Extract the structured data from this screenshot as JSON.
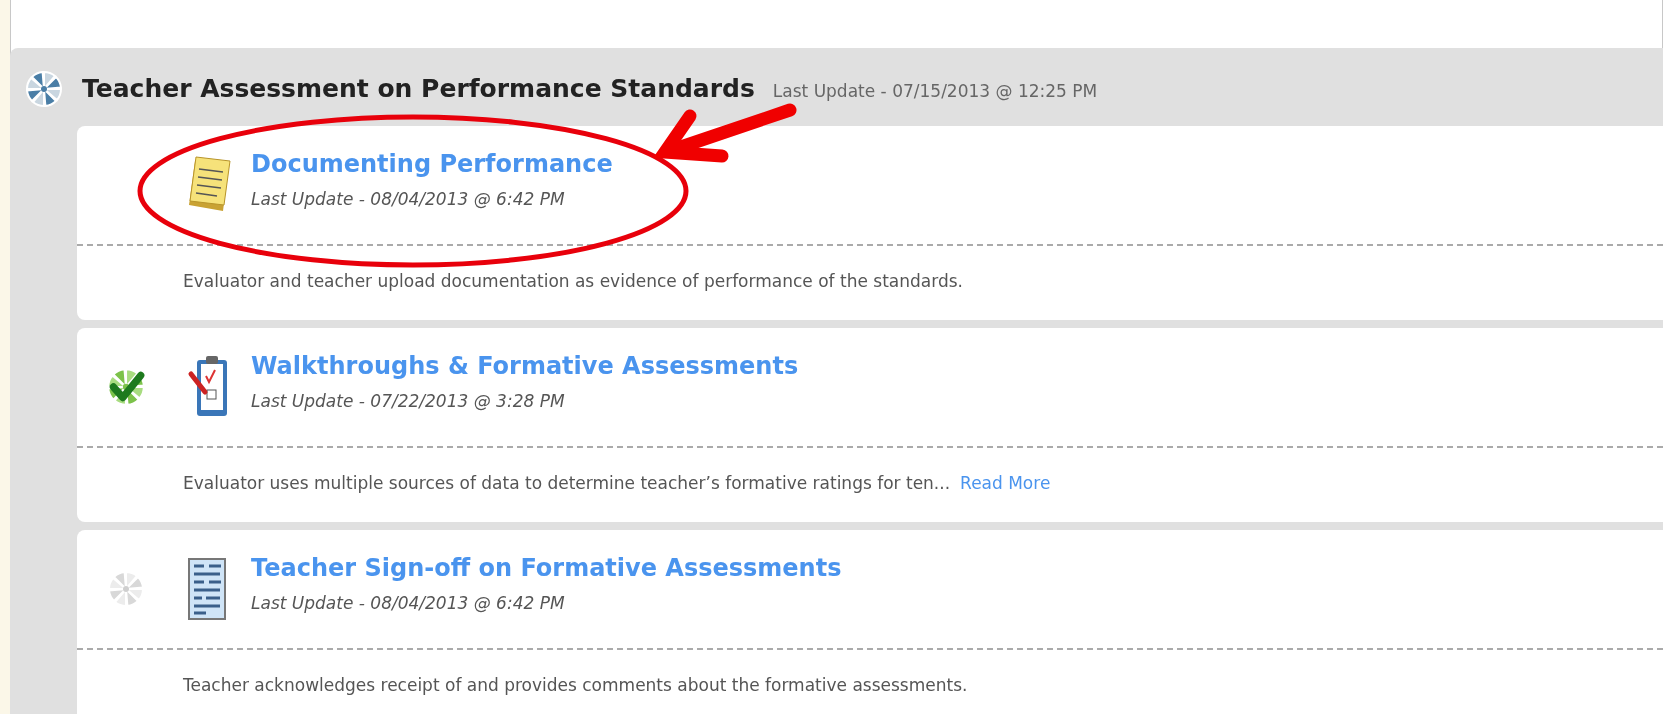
{
  "section": {
    "title": "Teacher Assessment on Performance Standards",
    "last_update": "Last Update - 07/15/2013 @ 12:25 PM"
  },
  "items": [
    {
      "kind": "notes",
      "title": "Documenting Performance",
      "last_update": "Last Update - 08/04/2013 @ 6:42 PM",
      "description": "Evaluator and teacher upload documentation as evidence of performance of the standards."
    },
    {
      "kind": "checklist",
      "completed": true,
      "title": "Walkthroughs & Formative Assessments",
      "last_update": "Last Update - 07/22/2013 @ 3:28 PM",
      "description": "Evaluator uses multiple sources of data to determine teacher’s formative ratings for ten...",
      "read_more": "Read More"
    },
    {
      "kind": "form",
      "completed": false,
      "title": "Teacher Sign-off on Formative Assessments",
      "last_update": "Last Update - 08/04/2013 @ 6:42 PM",
      "description": "Teacher acknowledges receipt of and provides comments about the formative assessments."
    }
  ]
}
